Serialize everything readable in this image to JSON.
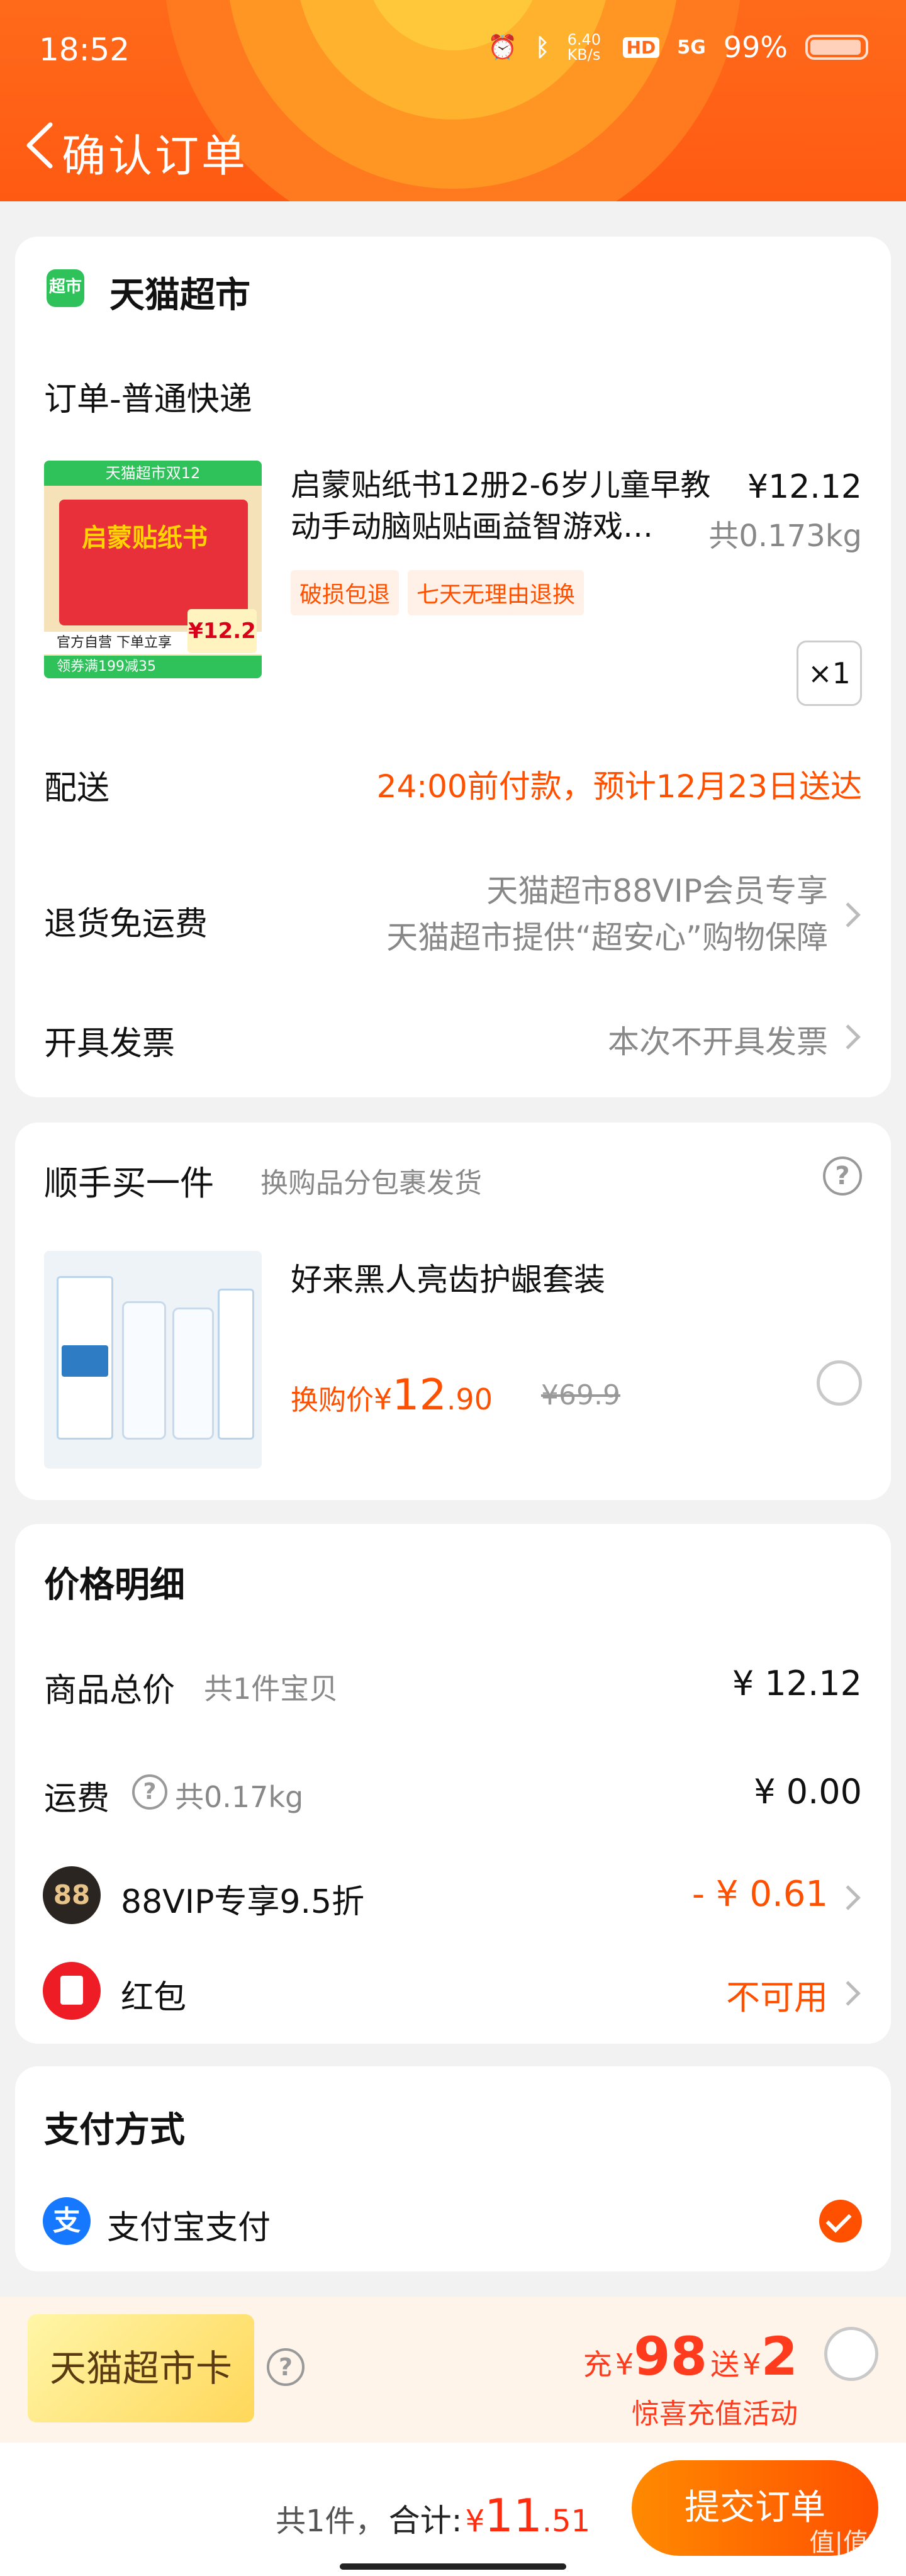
{
  "status_bar": {
    "time": "18:52",
    "net_speed": "6.40 KB/s",
    "hd": "HD",
    "signal": "5G",
    "battery": "99%"
  },
  "nav": {
    "title": "确认订单",
    "back_icon": "chevron-left-icon"
  },
  "store": {
    "badge": "超市",
    "name": "天猫超市"
  },
  "order": {
    "section_title": "订单-普通快递",
    "product": {
      "image_banner": "天猫超市双12",
      "image_title": "启蒙贴纸书",
      "image_strip": "官方自营 下单立享",
      "image_coupon": "领券满199减35",
      "image_price": "¥12.2",
      "title": "启蒙贴纸书12册2-6岁儿童早教动手动脑贴贴画益智游戏…",
      "price": "¥12.12",
      "weight": "共0.173kg",
      "tags": [
        "破损包退",
        "七天无理由退换"
      ],
      "quantity": "×1"
    },
    "delivery": {
      "label": "配送",
      "value": "24:00前付款，预计12月23日送达"
    },
    "return_shipping": {
      "label": "退货免运费",
      "line1": "天猫超市88VIP会员专享",
      "line2": "天猫超市提供“超安心”购物保障"
    },
    "invoice": {
      "label": "开具发票",
      "value": "本次不开具发票"
    }
  },
  "addon": {
    "title": "顺手买一件",
    "subtitle": "换购品分包裹发货",
    "help_icon": "question-circle-icon",
    "product": {
      "name": "好来黑人亮齿护龈套装",
      "price_label": "换购价",
      "currency": "¥",
      "price_int": "12",
      "price_dec": ".90",
      "original_price": "¥69.9"
    }
  },
  "price_detail": {
    "title": "价格明细",
    "items_total": {
      "label": "商品总价",
      "sub": "共1件宝贝",
      "value": "¥ 12.12"
    },
    "shipping": {
      "label": "运费",
      "sub": "共0.17kg",
      "value": "¥ 0.00"
    },
    "vip": {
      "icon_text": "88",
      "label": "88VIP专享9.5折",
      "value": "- ¥ 0.61"
    },
    "red_packet": {
      "label": "红包",
      "value": "不可用"
    }
  },
  "payment": {
    "title": "支付方式",
    "method_icon_text": "支",
    "method": "支付宝支付"
  },
  "card_promo": {
    "card_name": "天猫超市卡",
    "recharge_prefix": "充",
    "recharge_currency": "¥",
    "recharge_amount": "98",
    "gift_prefix": "送",
    "gift_currency": "¥",
    "gift_amount": "2",
    "activity": "惊喜充值活动"
  },
  "bottom_bar": {
    "count": "共1件，",
    "total_label": "合计:",
    "currency": "¥",
    "total_int": "11",
    "total_dec": ".51",
    "submit": "提交订单",
    "watermark": "值|值得"
  },
  "colors": {
    "accent": "#ff5000",
    "header": "#ff5a12",
    "price_red": "#ff2d10"
  }
}
